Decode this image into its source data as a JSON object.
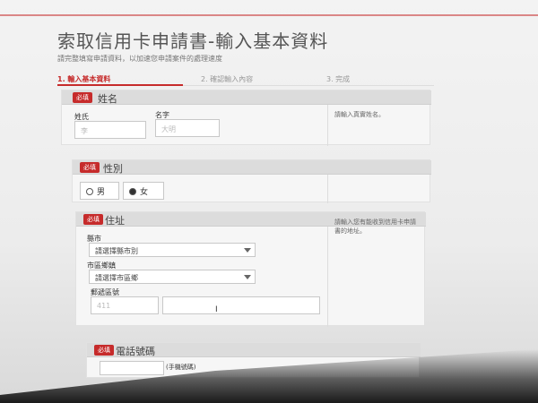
{
  "header": {
    "title": "索取信用卡申請書-輸入基本資料",
    "subtitle": "請完整填寫申請資料，以加速您申請案件的處理速度"
  },
  "steps": [
    {
      "label": "1. 輸入基本資料",
      "active": true
    },
    {
      "label": "2. 確認輸入內容",
      "active": false
    },
    {
      "label": "3. 完成",
      "active": false
    }
  ],
  "required_badge": "必填",
  "name_section": {
    "title": "姓名",
    "last_name_label": "姓氏",
    "last_name_placeholder": "李",
    "first_name_label": "名字",
    "first_name_placeholder": "大明",
    "note": "請輸入真實姓名。"
  },
  "gender_section": {
    "title": "性別",
    "options": [
      {
        "label": "男",
        "selected": false
      },
      {
        "label": "女",
        "selected": true
      }
    ]
  },
  "address_section": {
    "title": "住址",
    "city_label": "縣市",
    "city_value": "請選擇縣市別",
    "district_label": "市區鄉鎮",
    "district_value": "請選擇市區鄉",
    "zip_label": "郵遞區號",
    "zip_value": "411",
    "note": "請輸入您有能收到信用卡申請書的地址。"
  },
  "phone_section": {
    "title": "電話號碼",
    "hint": "(手機號碼)"
  }
}
